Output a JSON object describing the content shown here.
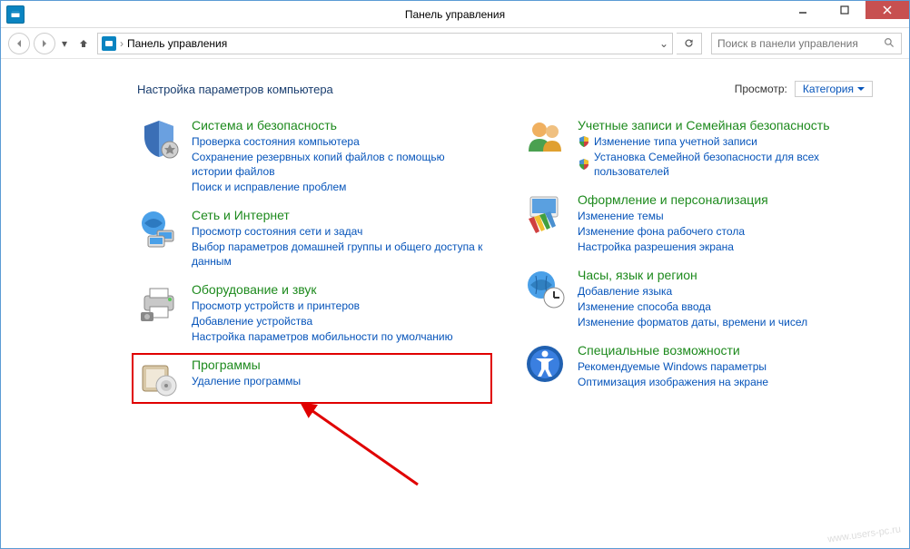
{
  "window_title": "Панель управления",
  "breadcrumb": "Панель управления",
  "search_placeholder": "Поиск в панели управления",
  "heading": "Настройка параметров компьютера",
  "viewby_label": "Просмотр:",
  "viewby_value": "Категория",
  "left": {
    "c0": {
      "title": "Система и безопасность",
      "l0": "Проверка состояния компьютера",
      "l1": "Сохранение резервных копий файлов с помощью истории файлов",
      "l2": "Поиск и исправление проблем"
    },
    "c1": {
      "title": "Сеть и Интернет",
      "l0": "Просмотр состояния сети и задач",
      "l1": "Выбор параметров домашней группы и общего доступа к данным"
    },
    "c2": {
      "title": "Оборудование и звук",
      "l0": "Просмотр устройств и принтеров",
      "l1": "Добавление устройства",
      "l2": "Настройка параметров мобильности по умолчанию"
    },
    "c3": {
      "title": "Программы",
      "l0": "Удаление программы"
    }
  },
  "right": {
    "c0": {
      "title": "Учетные записи и Семейная безопасность",
      "l0": "Изменение типа учетной записи",
      "l1": "Установка Семейной безопасности для всех пользователей"
    },
    "c1": {
      "title": "Оформление и персонализация",
      "l0": "Изменение темы",
      "l1": "Изменение фона рабочего стола",
      "l2": "Настройка разрешения экрана"
    },
    "c2": {
      "title": "Часы, язык и регион",
      "l0": "Добавление языка",
      "l1": "Изменение способа ввода",
      "l2": "Изменение форматов даты, времени и чисел"
    },
    "c3": {
      "title": "Специальные возможности",
      "l0": "Рекомендуемые Windows параметры",
      "l1": "Оптимизация изображения на экране"
    }
  },
  "watermark": "www.users-pc.ru"
}
